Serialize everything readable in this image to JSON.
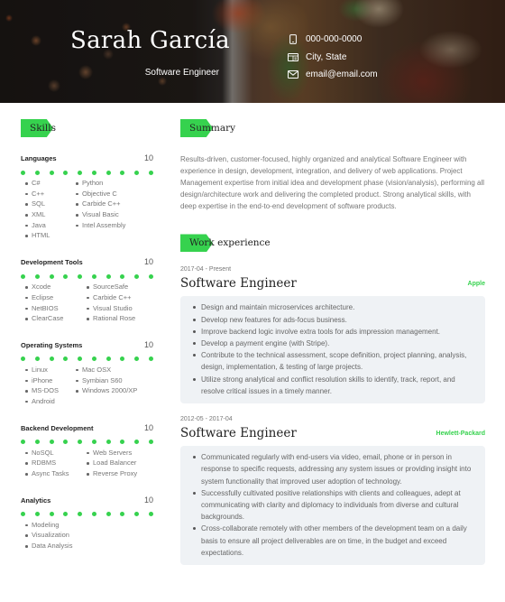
{
  "header": {
    "name": "Sarah García",
    "title": "Software Engineer",
    "contact": [
      {
        "icon": "phone-icon",
        "text": "000-000-0000"
      },
      {
        "icon": "address-card-icon",
        "text": "City, State"
      },
      {
        "icon": "envelope-icon",
        "text": "email@email.com"
      }
    ]
  },
  "colors": {
    "accent": "#36d24e",
    "box_bg": "#eff2f5"
  },
  "skills": {
    "heading": "Skills",
    "groups": [
      {
        "name": "Languages",
        "level": "10",
        "level_value": 10,
        "level_max": 10,
        "columns": [
          [
            "C#",
            "C++",
            "SQL",
            "XML",
            "Java",
            "HTML"
          ],
          [
            "Python",
            "Objective C",
            "Carbide C++",
            "Visual Basic",
            "Intel Assembly"
          ]
        ]
      },
      {
        "name": "Development Tools",
        "level": "10",
        "level_value": 10,
        "level_max": 10,
        "columns": [
          [
            "Xcode",
            "Eclipse",
            "NetBIOS",
            "ClearCase"
          ],
          [
            "SourceSafe",
            "Carbide C++",
            "Visual Studio",
            "Rational Rose"
          ]
        ]
      },
      {
        "name": "Operating Systems",
        "level": "10",
        "level_value": 10,
        "level_max": 10,
        "columns": [
          [
            "Linux",
            "iPhone",
            "MS-DOS",
            "Android"
          ],
          [
            "Mac OSX",
            "Symbian S60",
            "Windows 2000/XP"
          ]
        ]
      },
      {
        "name": "Backend Development",
        "level": "10",
        "level_value": 10,
        "level_max": 10,
        "columns": [
          [
            "NoSQL",
            "RDBMS",
            "Async Tasks"
          ],
          [
            "Web Servers",
            "Load Balancer",
            "Reverse Proxy"
          ]
        ]
      },
      {
        "name": "Analytics",
        "level": "10",
        "level_value": 10,
        "level_max": 10,
        "columns": [
          [
            "Modeling",
            "Visualization",
            "Data Analysis"
          ]
        ]
      }
    ]
  },
  "summary": {
    "heading": "Summary",
    "text": "Results-driven, customer-focused, highly organized and analytical Software Engineer with experience in design, development, integration, and delivery of web applications. Project Management expertise from initial idea and development phase (vision/analysis), performing all design/architecture work and delivering the completed product. Strong analytical skills, with deep expertise in the end-to-end development of software products."
  },
  "work": {
    "heading": "Work experience",
    "jobs": [
      {
        "date": "2017-04 - Present",
        "title": "Software Engineer",
        "company": "Apple",
        "bullets": [
          "Design and maintain microservices architecture.",
          "Develop new features for ads-focus business.",
          "Improve backend logic involve extra tools for ads impression management.",
          "Develop a payment engine (with Stripe).",
          "Contribute to the technical assessment, scope definition, project planning, analysis, design, implementation, & testing of large projects.",
          "Utilize strong analytical and conflict resolution skills to identify, track, report, and resolve critical issues in a timely manner."
        ]
      },
      {
        "date": "2012-05 - 2017-04",
        "title": "Software Engineer",
        "company": "Hewlett-Packard",
        "bullets": [
          "Communicated regularly with end-users via video, email, phone or in person in response to specific requests, addressing any system issues or providing insight into system functionality that improved user adoption of technology.",
          "Successfully cultivated positive relationships with clients and colleagues, adept at communicating with clarity and diplomacy to individuals from diverse and cultural backgrounds.",
          "Cross-collaborate remotely with other members of the development team on a daily basis to ensure all project deliverables are on time, in the budget and exceed expectations."
        ]
      }
    ]
  }
}
